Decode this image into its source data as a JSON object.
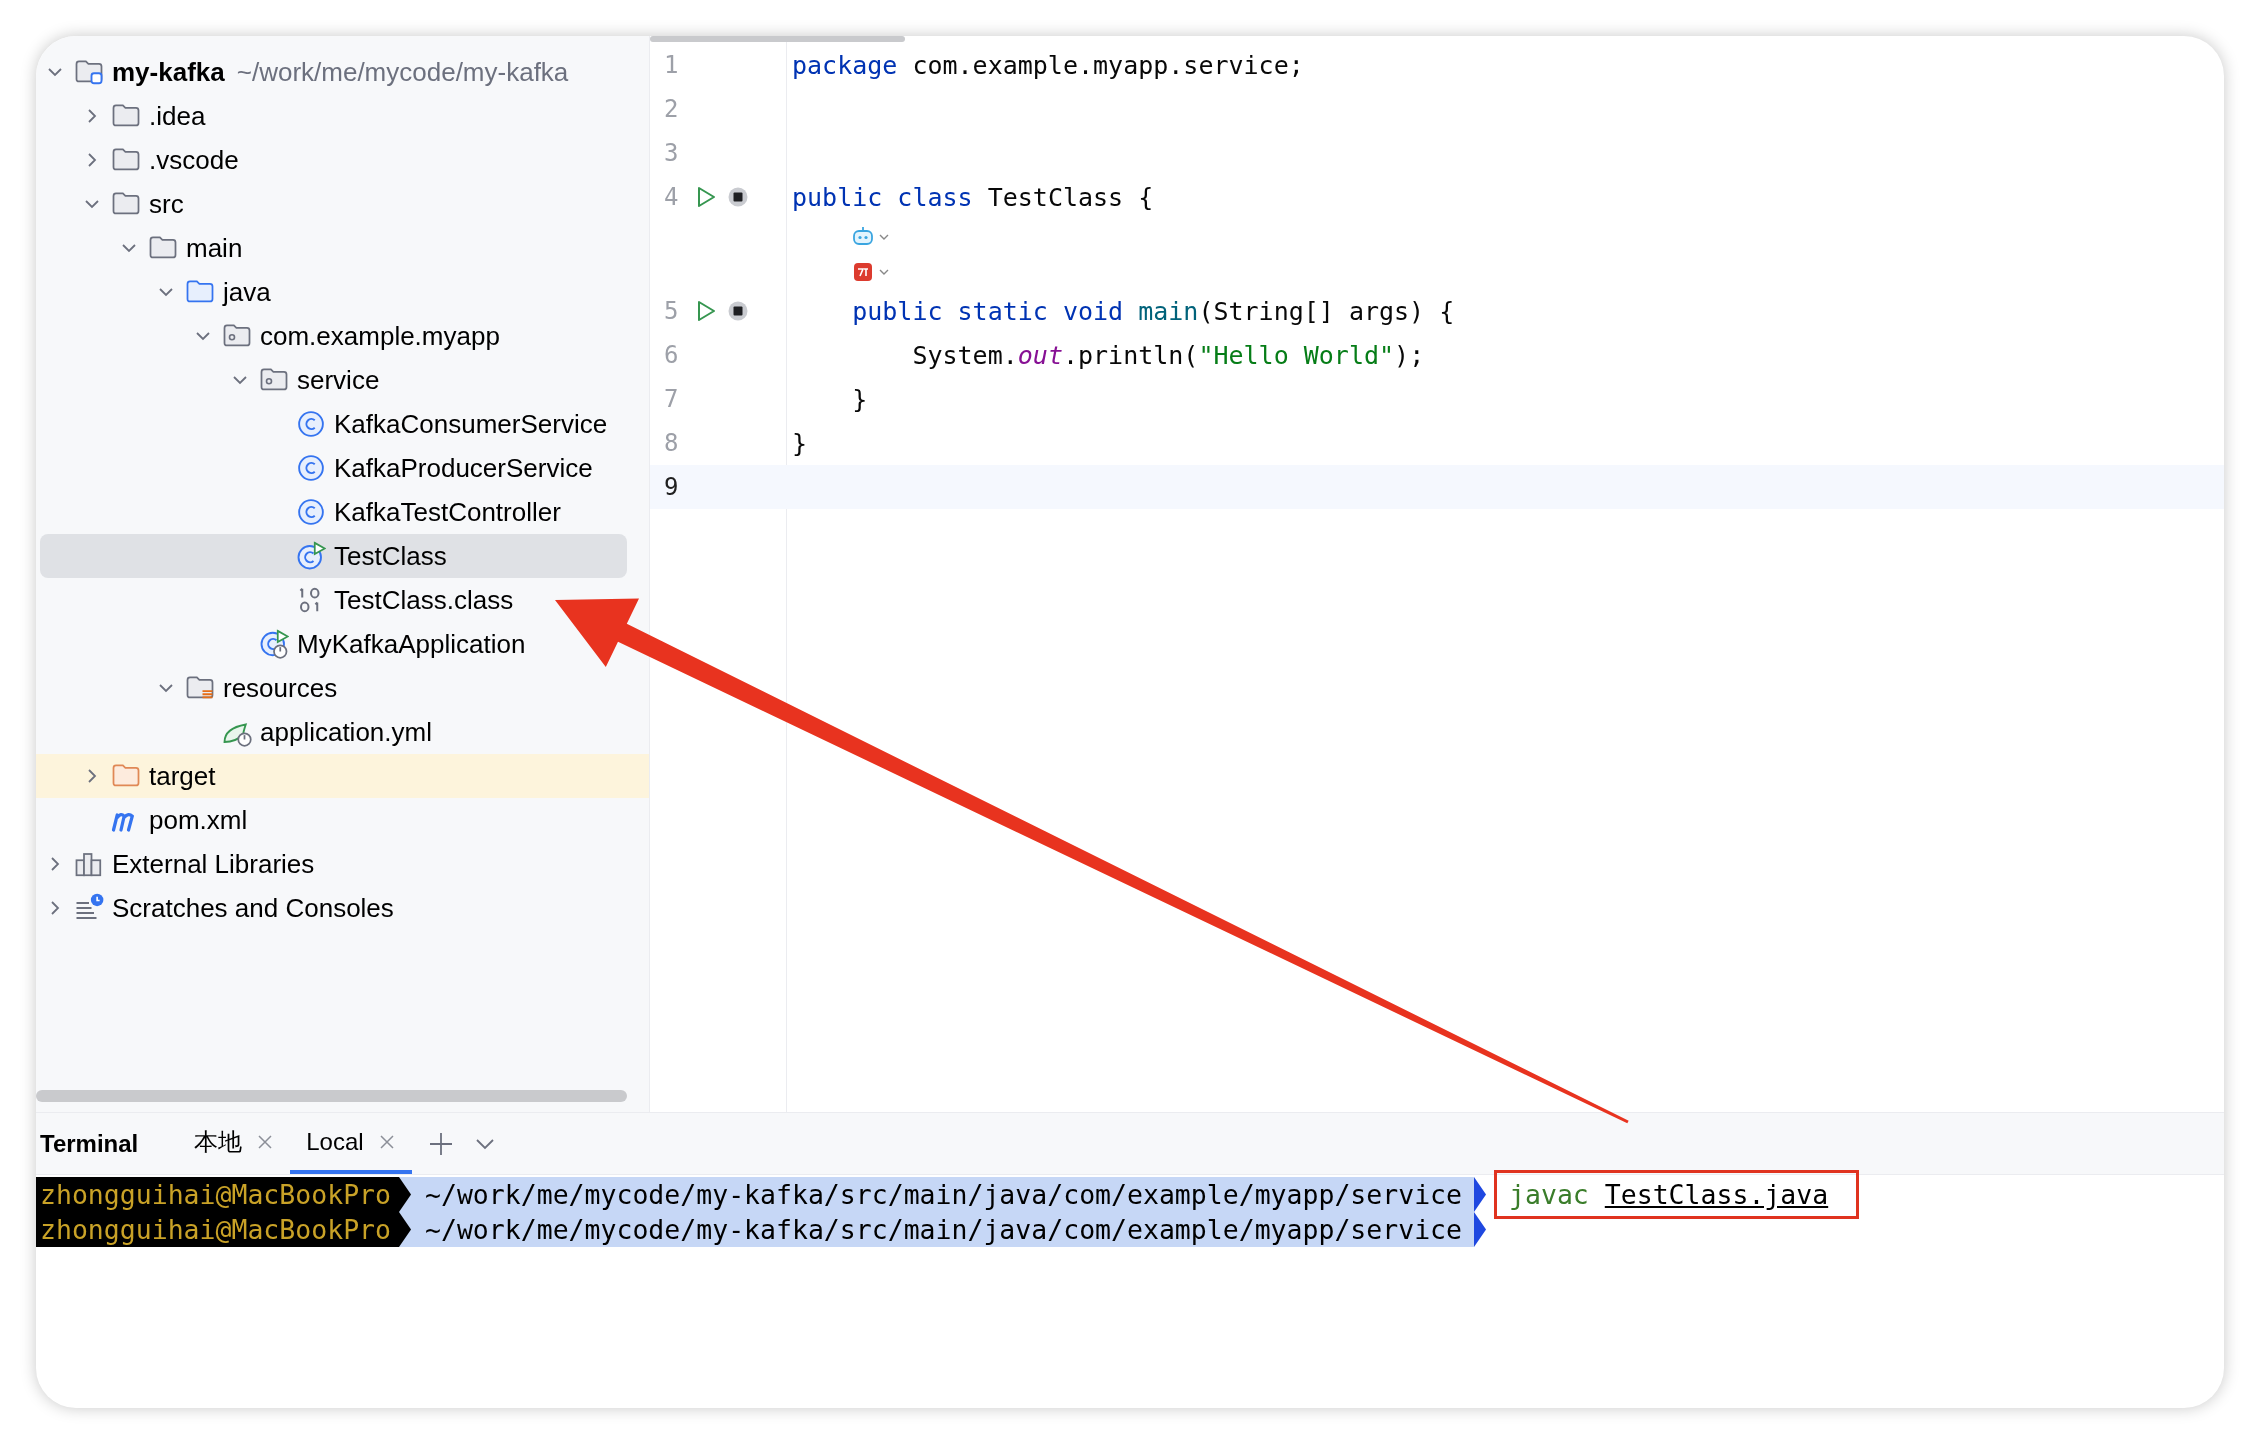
{
  "project_tree": {
    "items": [
      {
        "label": "my-kafka",
        "path": "~/work/me/mycode/my-kafka",
        "kind": "project",
        "expanded": true,
        "selected": false,
        "children": [
          {
            "label": ".idea",
            "kind": "folder",
            "expanded": false,
            "selected": false
          },
          {
            "label": ".vscode",
            "kind": "folder",
            "expanded": false,
            "selected": false
          },
          {
            "label": "src",
            "kind": "folder",
            "expanded": true,
            "selected": false,
            "children": [
              {
                "label": "main",
                "kind": "folder",
                "expanded": true,
                "selected": false,
                "children": [
                  {
                    "label": "java",
                    "kind": "source-folder",
                    "expanded": true,
                    "selected": false,
                    "children": [
                      {
                        "label": "com.example.myapp",
                        "kind": "package",
                        "expanded": true,
                        "selected": false,
                        "children": [
                          {
                            "label": "service",
                            "kind": "package",
                            "expanded": true,
                            "selected": false,
                            "children": [
                              {
                                "label": "KafkaConsumerService",
                                "kind": "class",
                                "selected": false
                              },
                              {
                                "label": "KafkaProducerService",
                                "kind": "class",
                                "selected": false
                              },
                              {
                                "label": "KafkaTestController",
                                "kind": "class",
                                "selected": false
                              },
                              {
                                "label": "TestClass",
                                "kind": "runnable-class",
                                "selected": true
                              },
                              {
                                "label": "TestClass.class",
                                "kind": "class-file",
                                "selected": false
                              }
                            ]
                          },
                          {
                            "label": "MyKafkaApplication",
                            "kind": "spring-app",
                            "selected": false
                          }
                        ]
                      }
                    ]
                  },
                  {
                    "label": "resources",
                    "kind": "resources-folder",
                    "expanded": true,
                    "selected": false,
                    "children": [
                      {
                        "label": "application.yml",
                        "kind": "spring-config",
                        "selected": false
                      }
                    ]
                  }
                ]
              }
            ]
          },
          {
            "label": "target",
            "kind": "excluded-folder",
            "expanded": false,
            "selected": false
          },
          {
            "label": "pom.xml",
            "kind": "maven",
            "selected": false
          }
        ]
      },
      {
        "label": "External Libraries",
        "kind": "libraries",
        "expanded": false,
        "selected": false
      },
      {
        "label": "Scratches and Consoles",
        "kind": "scratches",
        "expanded": false,
        "selected": false
      }
    ]
  },
  "editor": {
    "lines": [
      {
        "number": "1",
        "tokens": [
          {
            "kind": "keyword",
            "text": "package"
          },
          {
            "kind": "plain",
            "text": " com.example.myapp.service;"
          }
        ]
      },
      {
        "number": "2"
      },
      {
        "number": "3"
      },
      {
        "number": "4",
        "run": true,
        "tokens": [
          {
            "kind": "keyword",
            "text": "public class"
          },
          {
            "kind": "plain",
            "text": " TestClass {"
          }
        ]
      },
      {
        "number": "5",
        "run": true,
        "inlays": true,
        "tokens": [
          {
            "kind": "keyword",
            "text": "    public static void "
          },
          {
            "kind": "method",
            "text": "main"
          },
          {
            "kind": "plain",
            "text": "(String[] args) {"
          }
        ]
      },
      {
        "number": "6",
        "tokens": [
          {
            "kind": "plain",
            "text": "        System."
          },
          {
            "kind": "static-field",
            "text": "out"
          },
          {
            "kind": "plain",
            "text": ".println("
          },
          {
            "kind": "string",
            "text": "\"Hello World\""
          },
          {
            "kind": "plain",
            "text": ");"
          }
        ]
      },
      {
        "number": "7",
        "tokens": [
          {
            "kind": "plain",
            "text": "    }"
          }
        ]
      },
      {
        "number": "8",
        "tokens": [
          {
            "kind": "plain",
            "text": "}"
          }
        ]
      },
      {
        "number": "9",
        "current": true
      }
    ]
  },
  "terminal": {
    "title": "Terminal",
    "tabs": [
      {
        "label": "本地",
        "selected": false
      },
      {
        "label": "Local",
        "selected": true
      }
    ],
    "lines": [
      {
        "user": "zhongguihai@MacBookPro",
        "path": "~/work/me/mycode/my-kafka/src/main/java/com/example/myapp/service",
        "command": {
          "program": "javac",
          "argument": "TestClass.java",
          "highlighted": true
        }
      },
      {
        "user": "zhongguihai@MacBookPro",
        "path": "~/work/me/mycode/my-kafka/src/main/java/com/example/myapp/service"
      }
    ]
  }
}
